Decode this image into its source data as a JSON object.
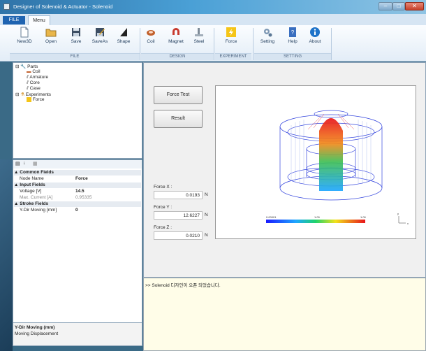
{
  "window": {
    "title": "Designer of Solenoid & Actuator - Solenoid"
  },
  "tabs": {
    "file": "FILE",
    "menu": "Menu"
  },
  "ribbon": {
    "file_group": {
      "label": "FILE",
      "buttons": [
        "New3D",
        "Open",
        "Save",
        "SaveAs",
        "Shape"
      ]
    },
    "design_group": {
      "label": "DESIGN",
      "buttons": [
        "Coil",
        "Magnet",
        "Steel"
      ]
    },
    "experiment_group": {
      "label": "EXPERIMENT",
      "buttons": [
        "Force"
      ]
    },
    "setting_group": {
      "label": "SETTING",
      "buttons": [
        "Setting",
        "Help",
        "About"
      ]
    }
  },
  "tree": {
    "parts": "Parts",
    "coil": "Coil",
    "armature": "Armature",
    "core": "Core",
    "case": "Case",
    "experiments": "Experiments",
    "force": "Force"
  },
  "properties": {
    "common_fields": "Common Fields",
    "node_name_label": "Node Name",
    "node_name_value": "Force",
    "input_fields": "Input Fields",
    "voltage_label": "Voltage [V]",
    "voltage_value": "14.5",
    "max_current_label": "Max. Current [A]",
    "max_current_value": "0.95335",
    "stroke_fields": "Stroke Fields",
    "ydir_label": "Y-Dir Moving [mm]",
    "ydir_value": "0"
  },
  "description": {
    "title": "Y-Dir Moving (mm)",
    "text": "Moving Displacement"
  },
  "main": {
    "force_test": "Force Test",
    "result": "Result",
    "force_x_label": "Force X :",
    "force_x_value": "0.0193",
    "force_y_label": "Force Y :",
    "force_y_value": "12.6227",
    "force_z_label": "Force Z :",
    "force_z_value": "0.0210",
    "unit": "N"
  },
  "viewer": {
    "colorbar_min": "0.00001",
    "colorbar_mid": "1.00",
    "colorbar_max": "1.00",
    "axis_y": "y",
    "axis_x": "x"
  },
  "console": {
    "message": ">> Solenoid 디자인이 오픈 되었습니다."
  },
  "colors": {
    "accent": "#1f64b1",
    "ribbon": "#e3edf7",
    "console_bg": "#fffde8"
  }
}
